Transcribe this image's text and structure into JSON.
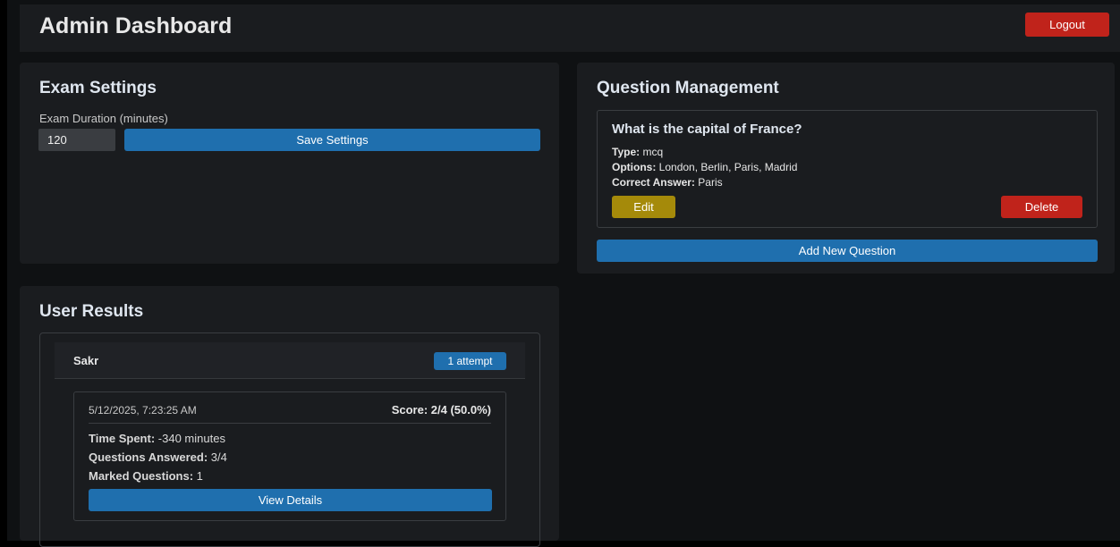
{
  "header": {
    "title": "Admin Dashboard",
    "logout_label": "Logout"
  },
  "exam_settings": {
    "title": "Exam Settings",
    "duration_label": "Exam Duration (minutes)",
    "duration_value": "120",
    "save_label": "Save Settings"
  },
  "question_management": {
    "title": "Question Management",
    "questions": [
      {
        "text": "What is the capital of France?",
        "type_label": "Type:",
        "type_value": "mcq",
        "options_label": "Options:",
        "options_value": "London, Berlin, Paris, Madrid",
        "answer_label": "Correct Answer:",
        "answer_value": "Paris",
        "edit_label": "Edit",
        "delete_label": "Delete"
      }
    ],
    "add_label": "Add New Question"
  },
  "user_results": {
    "title": "User Results",
    "users": [
      {
        "name": "Sakr",
        "attempts_badge": "1 attempt",
        "attempts": [
          {
            "timestamp": "5/12/2025, 7:23:25 AM",
            "score": "Score: 2/4 (50.0%)",
            "time_spent_label": "Time Spent:",
            "time_spent_value": "-340 minutes",
            "answered_label": "Questions Answered:",
            "answered_value": "3/4",
            "marked_label": "Marked Questions:",
            "marked_value": "1",
            "view_label": "View Details"
          }
        ]
      }
    ]
  },
  "colors": {
    "background": "#0f1113",
    "panel": "#1a1c1f",
    "primary": "#1f6fae",
    "danger": "#c0231b",
    "warning": "#a58a0a"
  }
}
